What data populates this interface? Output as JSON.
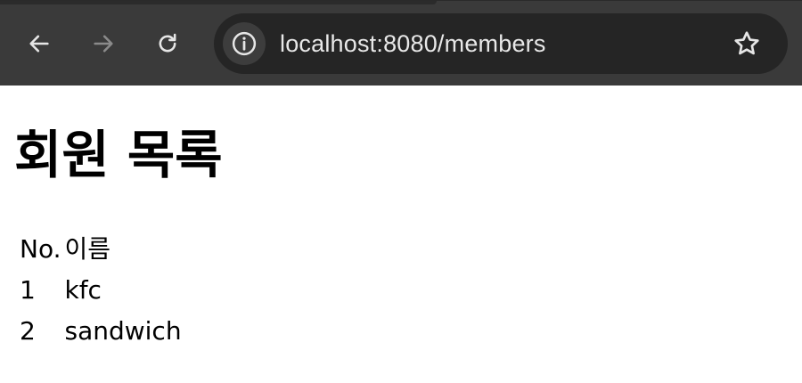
{
  "browser": {
    "url": "localhost:8080/members",
    "icons": {
      "back": "back-arrow-icon",
      "forward": "forward-arrow-icon",
      "reload": "reload-icon",
      "site_info": "info-icon",
      "bookmark": "star-icon"
    },
    "colors": {
      "toolbar": "#3a3a3a",
      "omnibox": "#252525",
      "icon_active": "#e6e6e6",
      "icon_disabled": "#8a8a8a"
    }
  },
  "page": {
    "title": "회원 목록",
    "table": {
      "headers": {
        "no": "No.",
        "name": "이름"
      },
      "rows": [
        {
          "no": "1",
          "name": "kfc"
        },
        {
          "no": "2",
          "name": "sandwich"
        }
      ]
    }
  }
}
